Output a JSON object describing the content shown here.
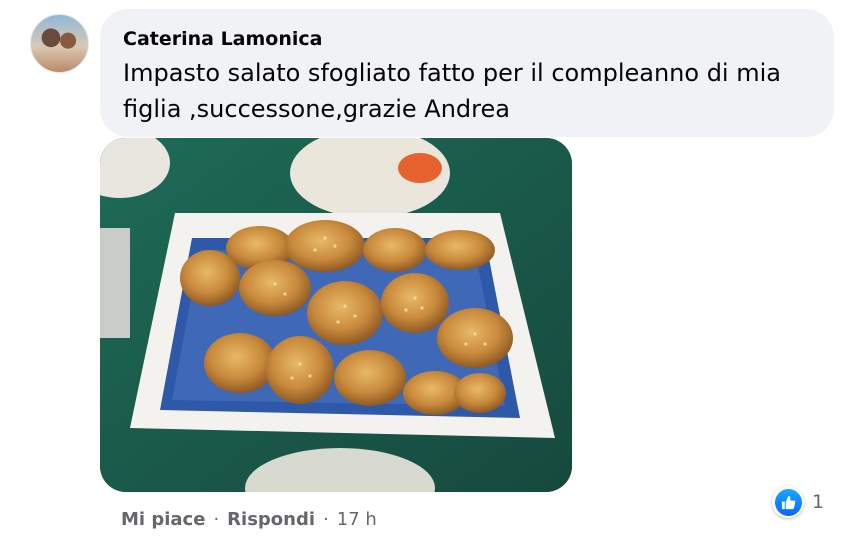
{
  "comment": {
    "author": "Caterina Lamonica",
    "text": "Impasto salato sfogliato fatto per il compleanno di mia figlia ,successone,grazie Andrea"
  },
  "reactions": {
    "icon": "like-icon",
    "count": "1",
    "color": "#0866ff"
  },
  "actions": {
    "like_label": "Mi piace",
    "separator": "·",
    "reply_label": "Rispondi",
    "timestamp": "17 h"
  }
}
